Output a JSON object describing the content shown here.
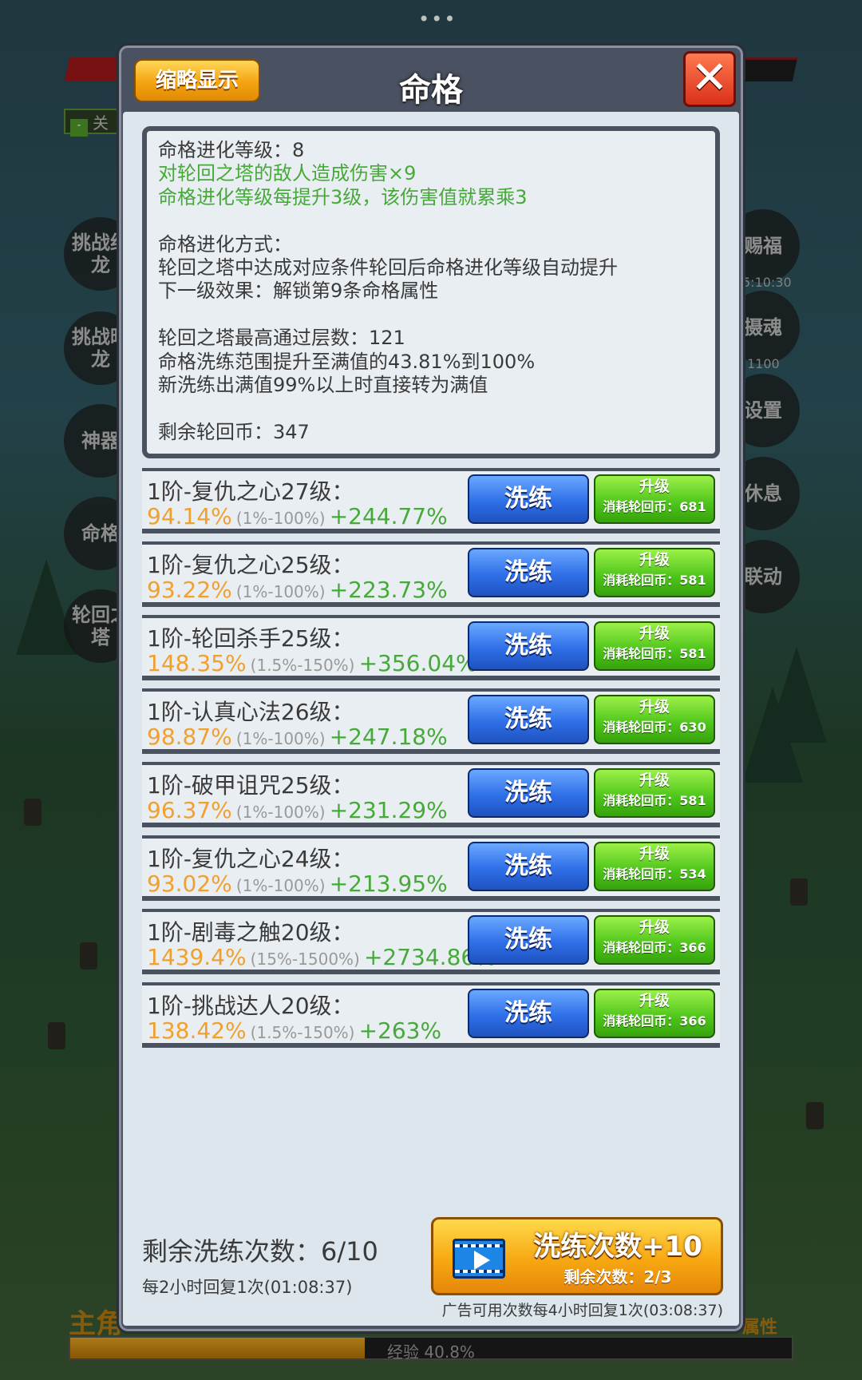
{
  "top_dots": "•••",
  "background": {
    "left_chip": "关",
    "side_buttons_left": [
      "挑战红龙",
      "挑战暗龙",
      "神器",
      "命格",
      "轮回之塔"
    ],
    "side_buttons_right": [
      "赐福",
      "摄魂",
      "设置",
      "休息",
      "联动"
    ],
    "side_sub_1": "5:10:30",
    "side_sub_2": "1100",
    "bottom_left": "主角",
    "bottom_right": "属性",
    "exp_label": "经验 40.8%",
    "exp_progress": 0.408
  },
  "dialog": {
    "title": "命格",
    "thumbnail_button": "缩略显示",
    "close_label": "✕"
  },
  "info": {
    "lines": [
      {
        "text": "命格进化等级：8",
        "green": false
      },
      {
        "text": "对轮回之塔的敌人造成伤害×9",
        "green": true
      },
      {
        "text": "命格进化等级每提升3级，该伤害值就累乘3",
        "green": true
      },
      {
        "text": "",
        "green": false
      },
      {
        "text": "命格进化方式：",
        "green": false
      },
      {
        "text": "轮回之塔中达成对应条件轮回后命格进化等级自动提升",
        "green": false
      },
      {
        "text": "下一级效果：解锁第9条命格属性",
        "green": false
      },
      {
        "text": "",
        "green": false
      },
      {
        "text": "轮回之塔最高通过层数：121",
        "green": false
      },
      {
        "text": "命格洗练范围提升至满值的43.81%到100%",
        "green": false
      },
      {
        "text": "新洗练出满值99%以上时直接转为满值",
        "green": false
      },
      {
        "text": "",
        "green": false
      },
      {
        "text": "剩余轮回币：347",
        "green": false
      }
    ]
  },
  "rows": [
    {
      "name": "1阶-复仇之心27级：",
      "value": "94.14%",
      "range": "(1%-100%)",
      "bonus": "+244.77%",
      "refine": "洗练",
      "upgrade": "升级",
      "cost": "消耗轮回币：681"
    },
    {
      "name": "1阶-复仇之心25级：",
      "value": "93.22%",
      "range": "(1%-100%)",
      "bonus": "+223.73%",
      "refine": "洗练",
      "upgrade": "升级",
      "cost": "消耗轮回币：581"
    },
    {
      "name": "1阶-轮回杀手25级：",
      "value": "148.35%",
      "range": "(1.5%-150%)",
      "bonus": "+356.04%",
      "refine": "洗练",
      "upgrade": "升级",
      "cost": "消耗轮回币：581"
    },
    {
      "name": "1阶-认真心法26级：",
      "value": "98.87%",
      "range": "(1%-100%)",
      "bonus": "+247.18%",
      "refine": "洗练",
      "upgrade": "升级",
      "cost": "消耗轮回币：630"
    },
    {
      "name": "1阶-破甲诅咒25级：",
      "value": "96.37%",
      "range": "(1%-100%)",
      "bonus": "+231.29%",
      "refine": "洗练",
      "upgrade": "升级",
      "cost": "消耗轮回币：581"
    },
    {
      "name": "1阶-复仇之心24级：",
      "value": "93.02%",
      "range": "(1%-100%)",
      "bonus": "+213.95%",
      "refine": "洗练",
      "upgrade": "升级",
      "cost": "消耗轮回币：534"
    },
    {
      "name": "1阶-剧毒之触20级：",
      "value": "1439.4%",
      "range": "(15%-1500%)",
      "bonus": "+2734.86%",
      "refine": "洗练",
      "upgrade": "升级",
      "cost": "消耗轮回币：366"
    },
    {
      "name": "1阶-挑战达人20级：",
      "value": "138.42%",
      "range": "(1.5%-150%)",
      "bonus": "+263%",
      "refine": "洗练",
      "upgrade": "升级",
      "cost": "消耗轮回币：366"
    }
  ],
  "footer": {
    "remaining": "剩余洗练次数：6/10",
    "recover": "每2小时回复1次(01:08:37)",
    "ad_button": "洗练次数+10",
    "ad_remaining": "剩余次数：2/3",
    "ad_note": "广告可用次数每4小时回复1次(03:08:37)"
  }
}
